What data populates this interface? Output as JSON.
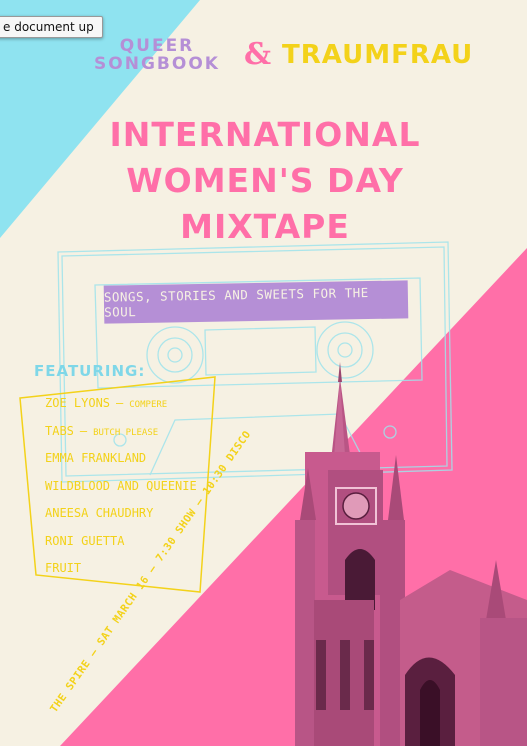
{
  "tooltip": {
    "text": "e document up"
  },
  "brands": {
    "left_line1": "QUEER",
    "left_line2": "SONGBOOK",
    "ampersand": "&",
    "right": "TRAUMFRAU"
  },
  "headline": {
    "line1": "INTERNATIONAL",
    "line2": "WOMEN'S DAY",
    "line3": "MIXTAPE"
  },
  "tagline": "SONGS, STORIES AND SWEETS FOR THE SOUL",
  "featuring": {
    "heading": "FEATURING:",
    "artists": [
      {
        "name": "ZOE LYONS",
        "separator": "–",
        "role": "COMPERE"
      },
      {
        "name": "TABS",
        "separator": "–",
        "role": "BUTCH PLEASE"
      },
      {
        "name": "EMMA FRANKLAND"
      },
      {
        "name": "WILDBLOOD AND QUEENIE"
      },
      {
        "name": "ANEESA CHAUDHRY"
      },
      {
        "name": "RONI GUETTA"
      },
      {
        "name": "FRUIT"
      }
    ]
  },
  "event_details": "THE SPIRE – SAT MARCH 16 – 7:30 SHOW – 10:30 DISCO",
  "colors": {
    "cream": "#f6f1e3",
    "cyan": "#8fe3f0",
    "pink": "#ff6fa8",
    "purple": "#b58fd6",
    "yellow": "#f3d21a",
    "photo_tint": "#c85a8e"
  },
  "icons": [
    "cassette-tape-outline-icon",
    "church-spire-photo-icon",
    "yellow-outline-frame-icon"
  ]
}
